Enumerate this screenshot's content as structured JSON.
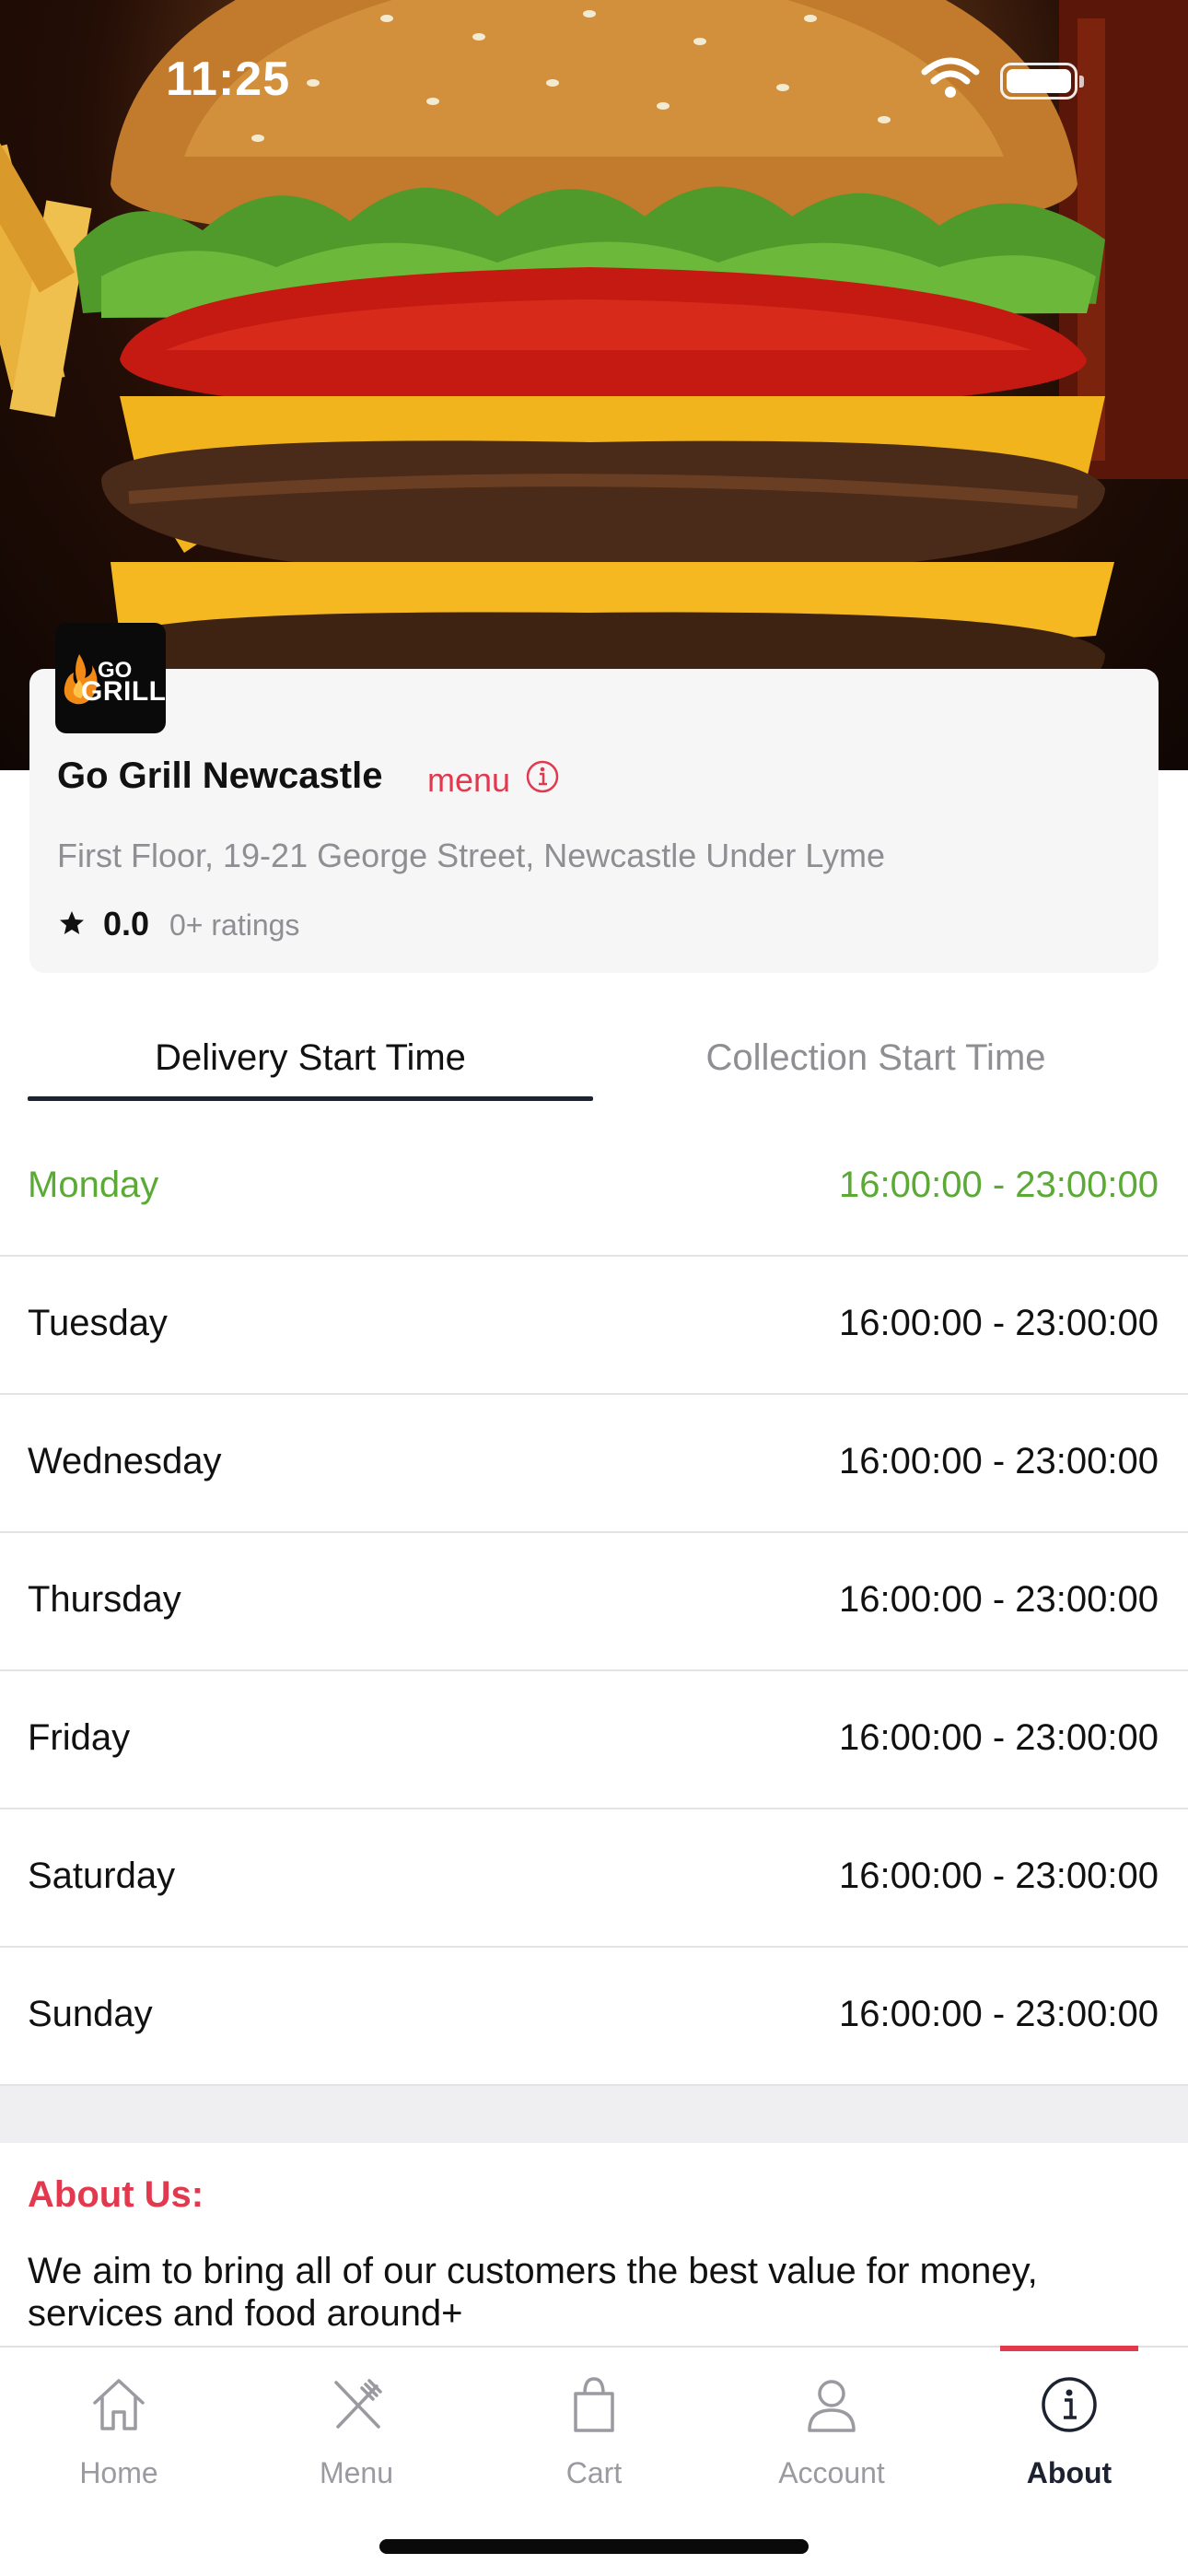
{
  "status_bar": {
    "time": "11:25"
  },
  "restaurant": {
    "logo_text_top": "GO",
    "logo_text_bottom": "GRILL",
    "name": "Go Grill Newcastle",
    "menu_link": "menu",
    "address": "First Floor, 19-21 George Street, Newcastle Under Lyme",
    "rating": "0.0",
    "rating_count": "0+ ratings"
  },
  "tabs": [
    {
      "label": "Delivery Start Time",
      "active": true
    },
    {
      "label": "Collection Start Time",
      "active": false
    }
  ],
  "hours": [
    {
      "day": "Monday",
      "time": "16:00:00 - 23:00:00",
      "today": true
    },
    {
      "day": "Tuesday",
      "time": "16:00:00 - 23:00:00",
      "today": false
    },
    {
      "day": "Wednesday",
      "time": "16:00:00 - 23:00:00",
      "today": false
    },
    {
      "day": "Thursday",
      "time": "16:00:00 - 23:00:00",
      "today": false
    },
    {
      "day": "Friday",
      "time": "16:00:00 - 23:00:00",
      "today": false
    },
    {
      "day": "Saturday",
      "time": "16:00:00 - 23:00:00",
      "today": false
    },
    {
      "day": "Sunday",
      "time": "16:00:00 - 23:00:00",
      "today": false
    }
  ],
  "about": {
    "heading": "About Us:",
    "text": "We aim to bring all of our customers the best value for money, services and food around+"
  },
  "nav": [
    {
      "label": "Home",
      "icon": "home-icon",
      "active": false
    },
    {
      "label": "Menu",
      "icon": "fork-knife-icon",
      "active": false
    },
    {
      "label": "Cart",
      "icon": "shopping-bag-icon",
      "active": false
    },
    {
      "label": "Account",
      "icon": "person-icon",
      "active": false
    },
    {
      "label": "About",
      "icon": "info-icon",
      "active": true
    }
  ],
  "colors": {
    "accent": "#e2394f",
    "today_green": "#5aaa35",
    "nav_active": "#1c2230",
    "muted": "#8e8e93"
  }
}
